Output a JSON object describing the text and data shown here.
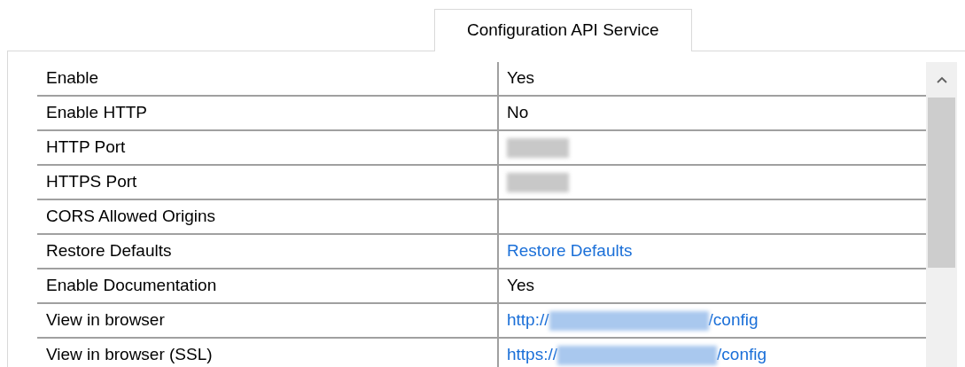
{
  "tabs": [
    {
      "label": "Configuration API Service",
      "selected": true
    }
  ],
  "properties": [
    {
      "name": "Enable",
      "kind": "text",
      "value": "Yes"
    },
    {
      "name": "Enable HTTP",
      "kind": "text",
      "value": "No"
    },
    {
      "name": "HTTP Port",
      "kind": "redacted"
    },
    {
      "name": "HTTPS Port",
      "kind": "redacted"
    },
    {
      "name": "CORS Allowed Origins",
      "kind": "empty"
    },
    {
      "name": "Restore Defaults",
      "kind": "link",
      "value": "Restore Defaults"
    },
    {
      "name": "Enable Documentation",
      "kind": "text",
      "value": "Yes"
    },
    {
      "name": "View in browser",
      "kind": "url",
      "prefix": "http://",
      "suffix": "/config"
    },
    {
      "name": "View in browser (SSL)",
      "kind": "url",
      "prefix": "https://",
      "suffix": "/config"
    }
  ]
}
